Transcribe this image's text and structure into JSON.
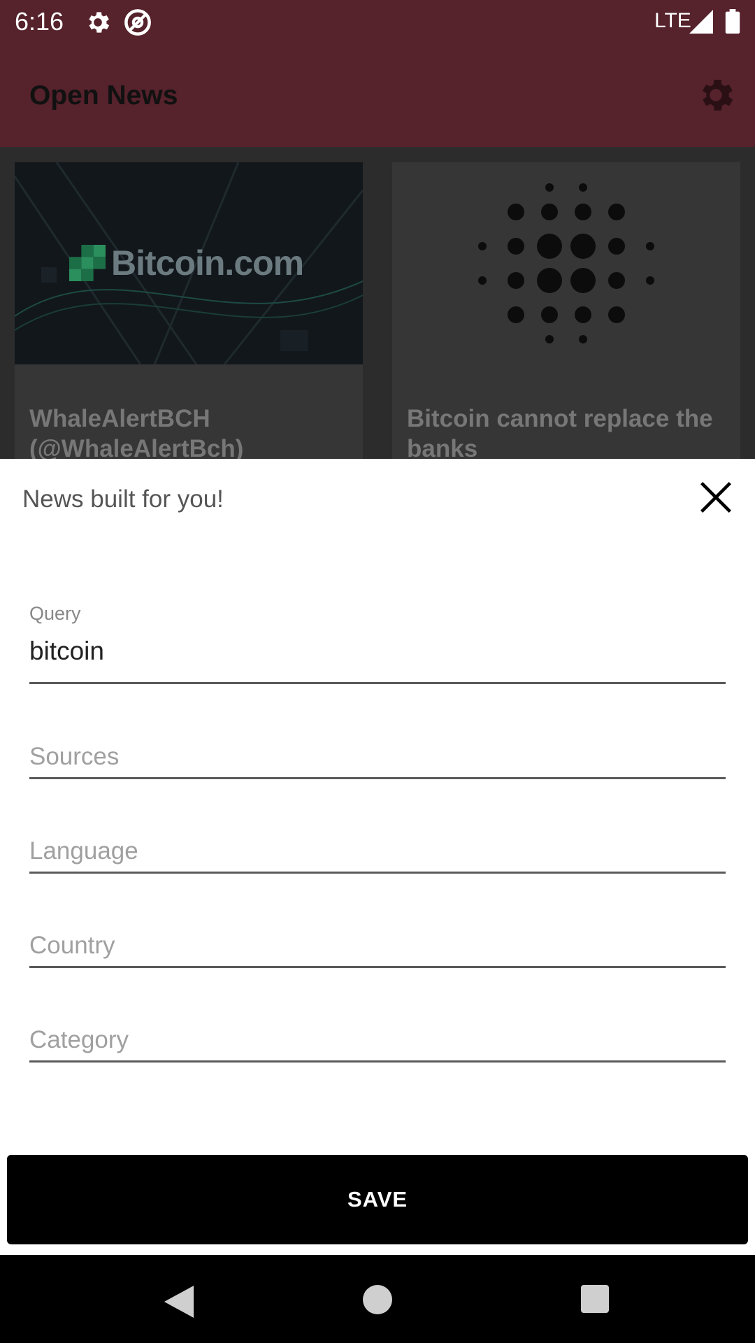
{
  "status_bar": {
    "time": "6:16",
    "network": "LTE",
    "icons": [
      "gear-icon",
      "at-sign-icon",
      "signal-icon",
      "battery-icon"
    ]
  },
  "app_bar": {
    "title": "Open News",
    "settings_icon": "gear-icon",
    "background_color": "#56222c"
  },
  "articles": [
    {
      "image_logo_text": "Bitcoin.com",
      "title": "WhaleAlertBCH (@WhaleAlertBch)"
    },
    {
      "image_icon": "dot-pattern-logo",
      "title": "Bitcoin cannot replace the banks"
    }
  ],
  "sheet": {
    "title": "News built for you!",
    "close_icon": "close-icon",
    "fields": {
      "query": {
        "label": "Query",
        "value": "bitcoin"
      },
      "sources": {
        "placeholder": "Sources"
      },
      "language": {
        "placeholder": "Language"
      },
      "country": {
        "placeholder": "Country"
      },
      "category": {
        "placeholder": "Category"
      }
    },
    "save_label": "SAVE"
  },
  "nav_bar": {
    "icons": [
      "back-icon",
      "home-icon",
      "recents-icon"
    ]
  }
}
